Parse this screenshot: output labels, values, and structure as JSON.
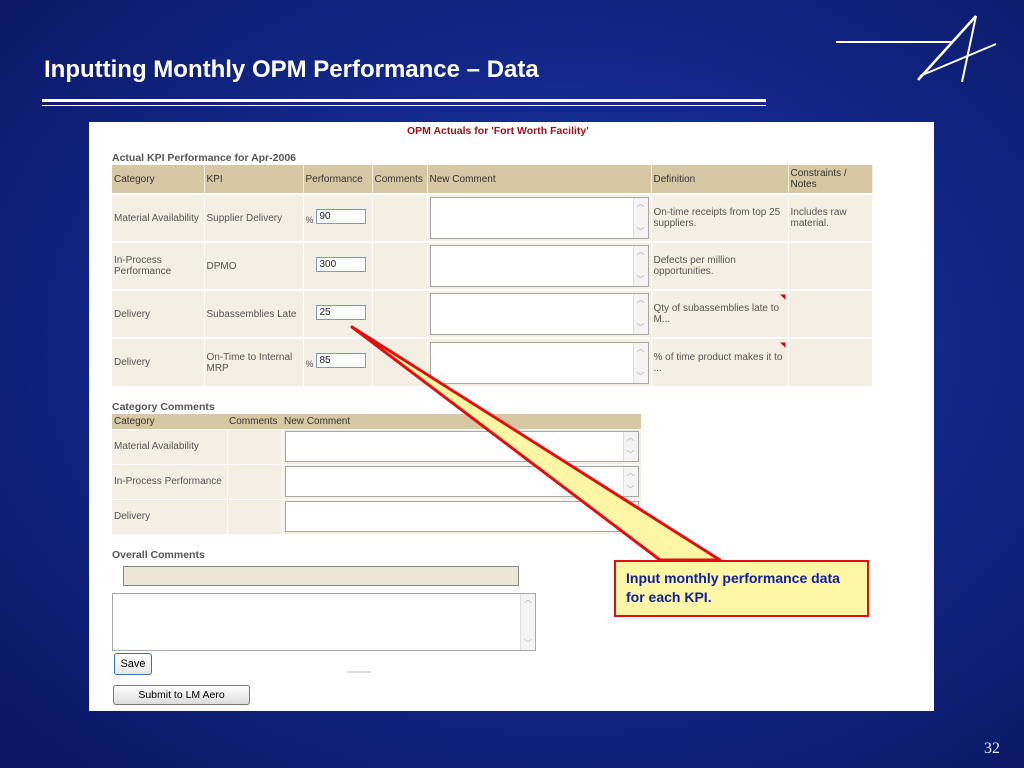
{
  "slide": {
    "title": "Inputting Monthly OPM Performance – Data",
    "page_number": "32",
    "logo": "lockheed-star-icon"
  },
  "screen": {
    "title": "OPM Actuals for 'Fort Worth Facility'",
    "kpi_section_title": "Actual KPI Performance for Apr-2006",
    "kpi_headers": [
      "Category",
      "KPI",
      "Performance",
      "Comments",
      "New Comment",
      "Definition",
      "Constraints / Notes"
    ],
    "kpi_rows": [
      {
        "category": "Material Availability",
        "kpi": "Supplier Delivery",
        "unit": "%",
        "value": "90",
        "definition": "On-time receipts from top 25 suppliers.",
        "notes": "Includes raw material."
      },
      {
        "category": "In-Process Performance",
        "kpi": "DPMO",
        "unit": "",
        "value": "300",
        "definition": "Defects per million opportunities.",
        "notes": ""
      },
      {
        "category": "Delivery",
        "kpi": "Subassemblies Late",
        "unit": "",
        "value": "25",
        "definition": "Qty of subassemblies late to M...",
        "notes": ""
      },
      {
        "category": "Delivery",
        "kpi": "On-Time to Internal MRP",
        "unit": "%",
        "value": "85",
        "definition": "% of time product makes it to ...",
        "notes": ""
      }
    ],
    "category_section_title": "Category Comments",
    "category_headers": [
      "Category",
      "Comments",
      "New Comment"
    ],
    "category_rows": [
      "Material Availability",
      "In-Process Performance",
      "Delivery"
    ],
    "overall_section_title": "Overall Comments",
    "save_label": "Save",
    "submit_label": "Submit to LM Aero"
  },
  "callout": {
    "text": "Input monthly performance data for each KPI."
  },
  "colors": {
    "background": "#13288a",
    "header_row": "#d8c7a3",
    "body_row": "#f4efe3",
    "title_red": "#a0101a",
    "callout_fill": "#fdf6a4",
    "callout_border": "#e01010",
    "callout_text": "#13209a"
  }
}
